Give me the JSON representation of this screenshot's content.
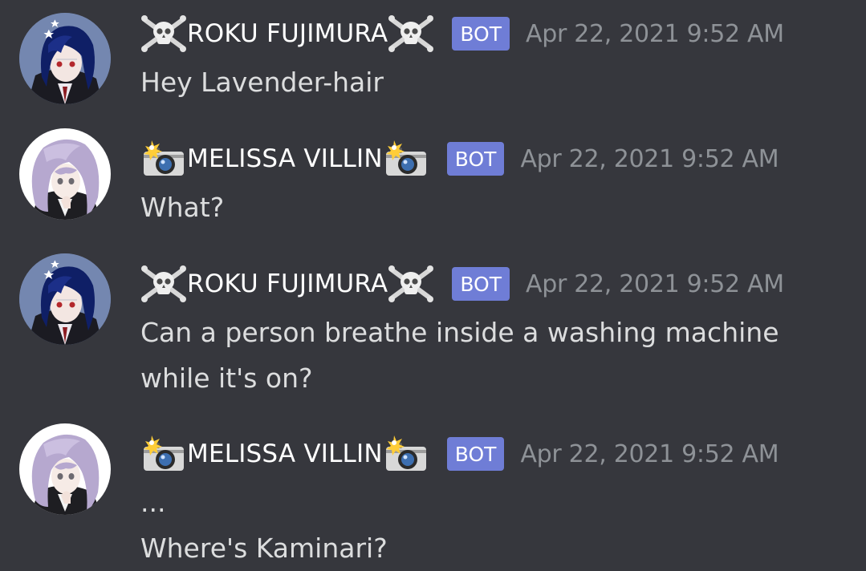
{
  "messages": [
    {
      "author": "ROKU FUJIMURA",
      "name_emoji": "skull-and-crossbones-emoji",
      "avatar": "dark-blue-hair-avatar",
      "badge": "BOT",
      "timestamp": "Apr 22, 2021 9:52 AM",
      "lines": [
        "Hey Lavender-hair"
      ]
    },
    {
      "author": "MELISSA VILLIN",
      "name_emoji": "camera-with-flash-emoji",
      "avatar": "lavender-hair-avatar",
      "badge": "BOT",
      "timestamp": "Apr 22, 2021 9:52 AM",
      "lines": [
        "What?"
      ]
    },
    {
      "author": "ROKU FUJIMURA",
      "name_emoji": "skull-and-crossbones-emoji",
      "avatar": "dark-blue-hair-avatar",
      "badge": "BOT",
      "timestamp": "Apr 22, 2021 9:52 AM",
      "lines": [
        "Can a person breathe inside a washing machine",
        "while it's on?"
      ]
    },
    {
      "author": "MELISSA VILLIN",
      "name_emoji": "camera-with-flash-emoji",
      "avatar": "lavender-hair-avatar",
      "badge": "BOT",
      "timestamp": "Apr 22, 2021 9:52 AM",
      "lines": [
        "...",
        "Where's Kaminari?"
      ]
    }
  ],
  "colors": {
    "background": "#36373d",
    "username": "#ffffff",
    "text": "#dcddde",
    "timestamp": "#8e9297",
    "bot_badge": "#6f7dd6"
  }
}
